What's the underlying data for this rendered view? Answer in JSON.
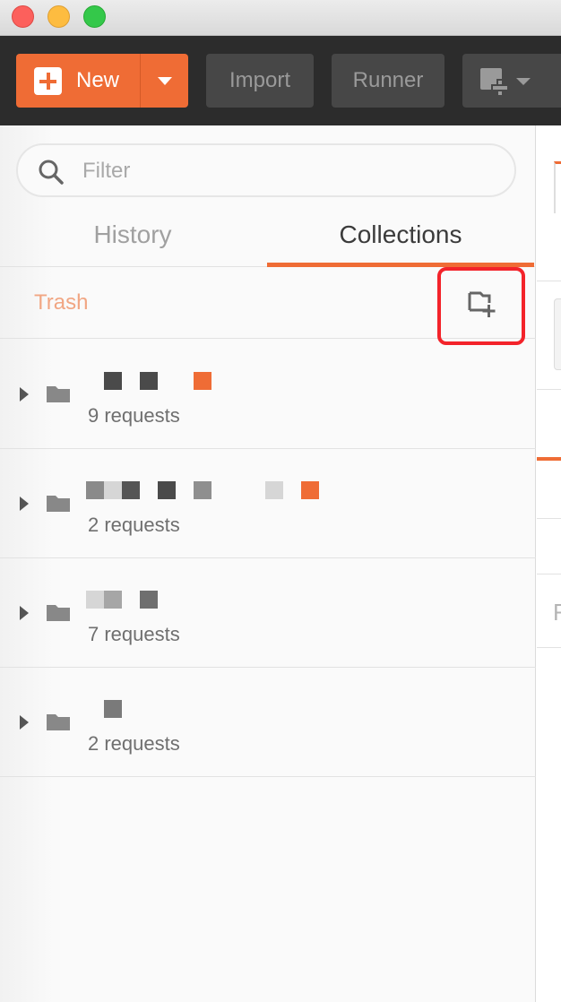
{
  "window": {
    "traffic_lights": [
      "close",
      "minimize",
      "zoom"
    ]
  },
  "toolbar": {
    "new_label": "New",
    "import_label": "Import",
    "runner_label": "Runner",
    "accent_color": "#ef6c35"
  },
  "sidebar": {
    "search": {
      "placeholder": "Filter",
      "value": ""
    },
    "tabs": [
      {
        "label": "History",
        "active": false
      },
      {
        "label": "Collections",
        "active": true
      }
    ],
    "trash_label": "Trash",
    "new_collection_icon": "folder-plus-icon",
    "collections": [
      {
        "requests_label": "9 requests"
      },
      {
        "requests_label": "2 requests"
      },
      {
        "requests_label": "7 requests"
      },
      {
        "requests_label": "2 requests"
      }
    ]
  },
  "right_panel": {
    "partial_char": "F"
  }
}
